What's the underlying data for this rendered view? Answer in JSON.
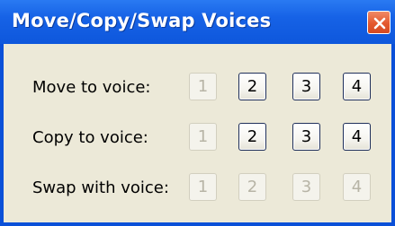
{
  "window": {
    "title": "Move/Copy/Swap Voices",
    "close_glyph": "close-icon"
  },
  "rows": [
    {
      "label": "Move to voice:",
      "buttons": [
        {
          "label": "1",
          "enabled": false
        },
        {
          "label": "2",
          "enabled": true
        },
        {
          "label": "3",
          "enabled": true
        },
        {
          "label": "4",
          "enabled": true
        }
      ]
    },
    {
      "label": "Copy to voice:",
      "buttons": [
        {
          "label": "1",
          "enabled": false
        },
        {
          "label": "2",
          "enabled": true
        },
        {
          "label": "3",
          "enabled": true
        },
        {
          "label": "4",
          "enabled": true
        }
      ]
    },
    {
      "label": "Swap with voice:",
      "buttons": [
        {
          "label": "1",
          "enabled": false
        },
        {
          "label": "2",
          "enabled": false
        },
        {
          "label": "3",
          "enabled": false
        },
        {
          "label": "4",
          "enabled": false
        }
      ]
    }
  ],
  "colors": {
    "titlebar": "#0e57dc",
    "client_bg": "#ece9d8",
    "close_button": "#e4582e",
    "enabled_border": "#1f2f5a",
    "disabled_text": "#b7b4a6"
  }
}
